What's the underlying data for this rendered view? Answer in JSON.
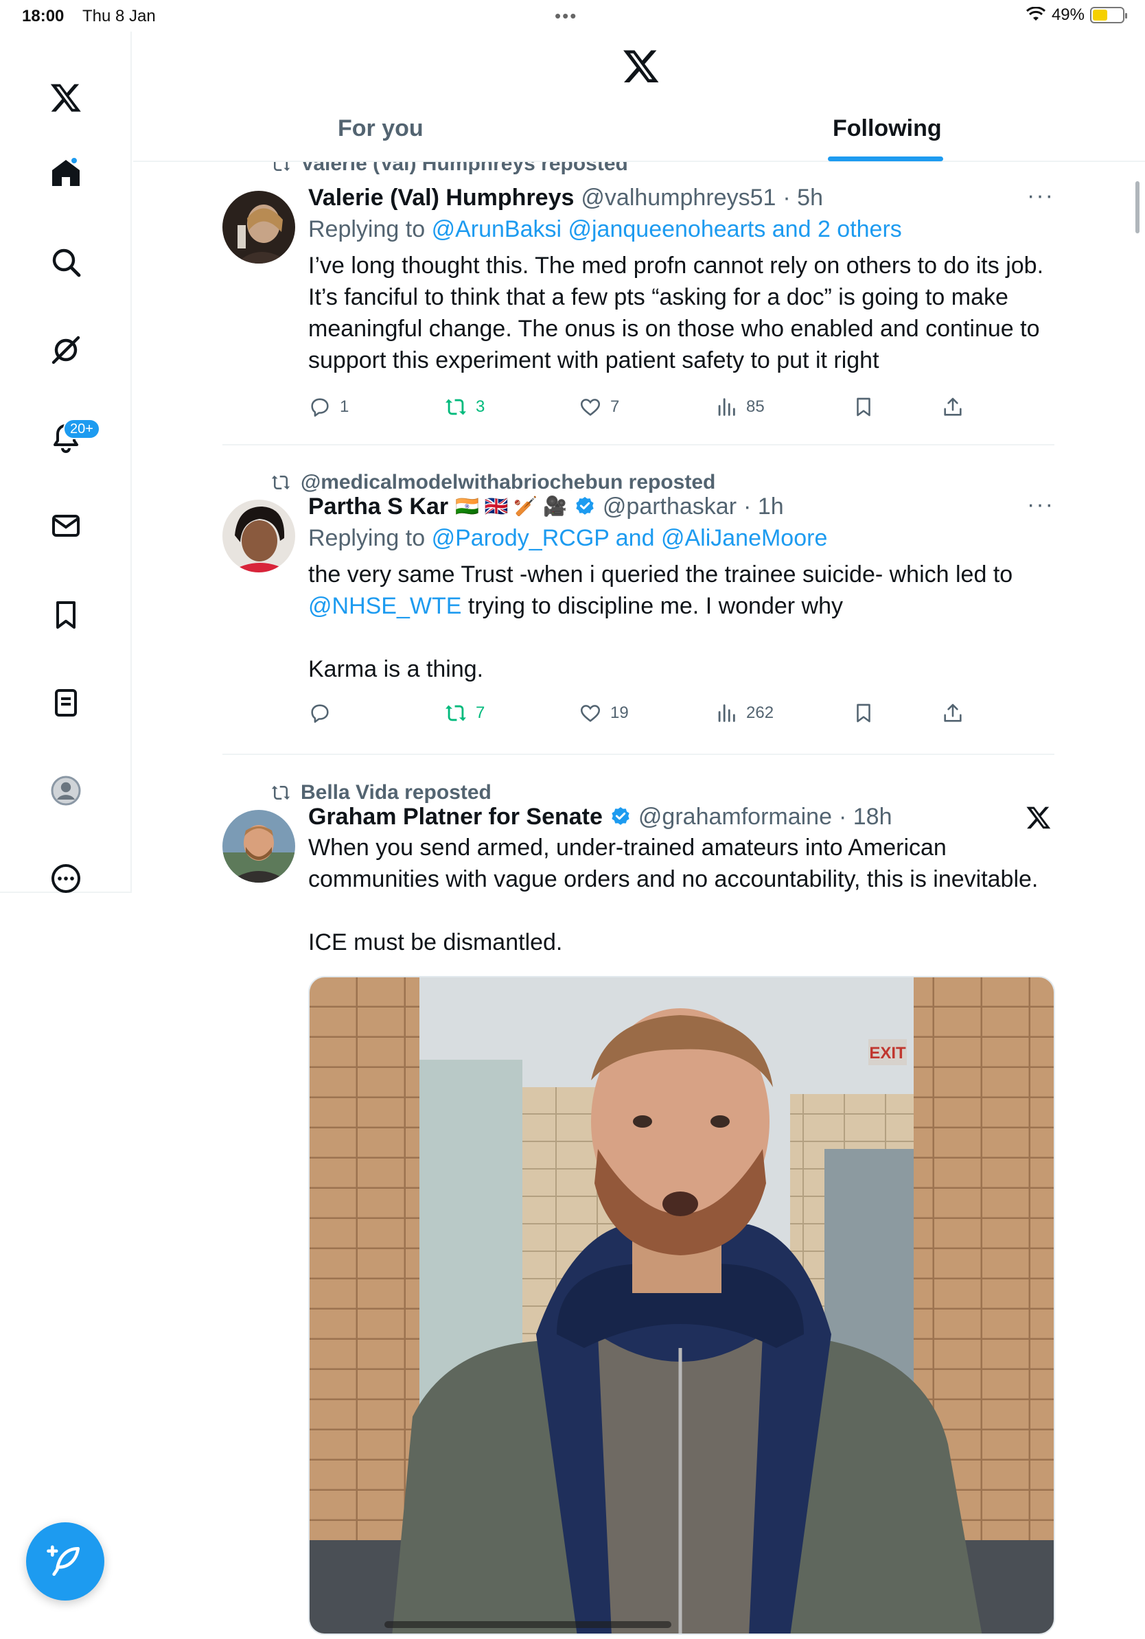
{
  "status": {
    "time": "18:00",
    "date": "Thu 8 Jan",
    "battery": "49%",
    "battery_level": 0.49
  },
  "sidebar": {
    "items": [
      {
        "icon": "x-logo-icon"
      },
      {
        "icon": "home-icon",
        "dot": true
      },
      {
        "icon": "search-icon"
      },
      {
        "icon": "grok-icon"
      },
      {
        "icon": "notifications-icon",
        "badge": "20+"
      },
      {
        "icon": "messages-icon"
      },
      {
        "icon": "bookmarks-icon"
      },
      {
        "icon": "lists-icon"
      },
      {
        "icon": "profile-icon"
      },
      {
        "icon": "more-icon"
      }
    ],
    "compose_icon": "compose-icon"
  },
  "header": {
    "tabs": [
      "For you",
      "Following"
    ],
    "active_tab": "Following"
  },
  "tweets": [
    {
      "repost_by": "Valerie (Val) Humphreys reposted",
      "name": "Valerie (Val) Humphreys",
      "handle": "@valhumphreys51",
      "time": "· 5h",
      "replying_prefix": "Replying to",
      "replying_to": "@ArunBaksi @janqueenohearts and 2 others",
      "text": [
        "I’ve long thought this. The med profn cannot rely on others to do its job. It’s fanciful to think that a few pts “asking for a doc” is going to make meaningful change. The onus is on those who enabled and continue to support this experiment with patient safety to put it right"
      ],
      "replies": "1",
      "reposts": "3",
      "likes": "7",
      "views": "85"
    },
    {
      "repost_by": "@medicalmodelwithabriochebun reposted",
      "name": "Partha S Kar",
      "name_emoji": "🇮🇳 🇬🇧 🏏 🎥",
      "handle": "@parthaskar",
      "time": "· 1h",
      "replying_prefix": "Replying to",
      "replying_to": "@Parody_RCGP and @AliJaneMoore",
      "text_a": "the very same Trust -when i queried the trainee suicide- which led to",
      "mention": "@NHSE_WTE",
      "text_b": " trying to discipline me. I wonder why",
      "text_c": "Karma is a thing.",
      "replies": "",
      "reposts": "7",
      "likes": "19",
      "views": "262"
    },
    {
      "repost_by": "Bella Vida reposted",
      "name": "Graham Platner for Senate",
      "handle": "@grahamformaine",
      "time": "· 18h",
      "text_a": "When you send armed, under-trained amateurs into American communities with vague orders and no accountability, this is inevitable.",
      "text_b": "ICE must be dismantled.",
      "media_sign": "EXIT"
    }
  ],
  "colors": {
    "accent": "#1d9bf0",
    "repost_green": "#00ba7c",
    "secondary_text": "#536471"
  }
}
